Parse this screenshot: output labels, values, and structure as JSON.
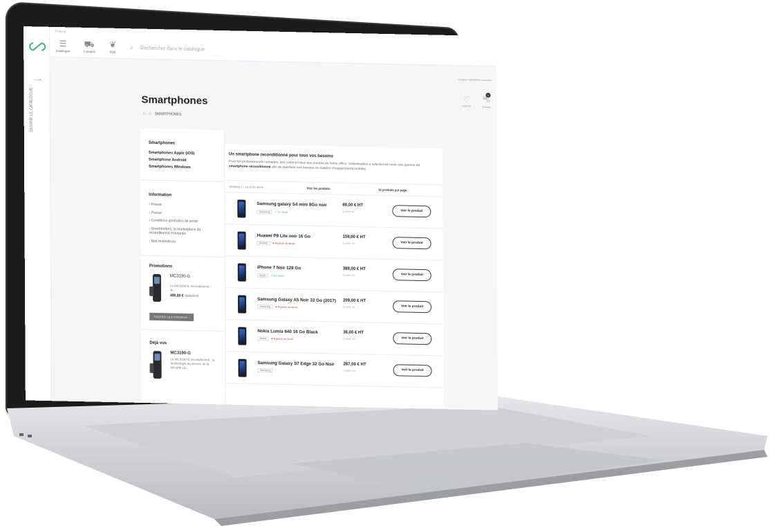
{
  "topbar": {
    "breadcrumb": "France",
    "nav": [
      {
        "label": "Catalogue",
        "icon": "hamburger-icon"
      },
      {
        "label": "A propos",
        "icon": "car-icon"
      },
      {
        "label": "RSE",
        "icon": "leaf-icon"
      }
    ],
    "search_placeholder": "Rechercher dans le catalogue",
    "links": "Livraison   Newsletter-connexion",
    "wishlist_label": "Favoris",
    "cart_label": "Panier",
    "cart_count": "0"
  },
  "rail": {
    "arrow": "⟶",
    "vertical_text": "Ouvrir le catalogue"
  },
  "page": {
    "title": "Smartphones",
    "crumb_current": "SMARTPHONES",
    "crumb_sep": "//"
  },
  "sidebar": {
    "categories_title": "Smartphones",
    "categories": [
      "Smartphones Apple (iOS)",
      "Smartphone Android",
      "Smartphones Windows"
    ],
    "info_title": "Information",
    "info_links": [
      "Presse",
      "Presse",
      "Conditions générales de vente",
      "Greentraders, la marketplace du reconditionné entreprise",
      "Nos revendeurs"
    ],
    "promo_title": "Promotions",
    "promo_item": {
      "name": "MC3190-G",
      "desc": "Le MC3190-G reconditionné : la...",
      "price": "490,00 €",
      "old_price": "550,00 €"
    },
    "promo_button": "TOUTES LES PROMOS",
    "seen_title": "Déjà vus",
    "seen_item": {
      "name": "MC3190-G",
      "desc": "Le MC3190-G reconditionné : la technologie au service de la sécurité La..."
    }
  },
  "main": {
    "intro_title": "Un smartphone reconditionné pour tous vos besoins",
    "intro_text_1": "Pour les professionnels nomades, des commerciaux aux mordus du home office, Greentraders a sélectionné toute une gamme de ",
    "intro_bold": "smartphone reconditionné",
    "intro_text_2": " afin de satisfaire vos besoins en matière d'équipements mobiles.",
    "showing": "Showing 1 - 10 of 21 items",
    "sort_label": "Trier les produits",
    "per_page": "12 produits par page",
    "from_label": "à partir de",
    "view_label": "Voir le produit",
    "products": [
      {
        "name": "Samsung galaxy S4 mini 8Go noir",
        "brand": "Samsung",
        "stock": "✓ En stock",
        "in_stock": true,
        "price": "69,00 € HT"
      },
      {
        "name": "Huawei P9 Lite noir 16 Go",
        "brand": "Huawei",
        "stock": "● Rupture de stock",
        "in_stock": false,
        "price": "159,00 € HT"
      },
      {
        "name": "iPhone 7 Noir 128 Go",
        "brand": "Apple",
        "stock": "✓ En stock",
        "in_stock": true,
        "price": "389,00 € HT"
      },
      {
        "name": "Samsung Galaxy A5 Noir 32 Go (2017)",
        "brand": "Samsung",
        "stock": "● Rupture de stock",
        "in_stock": false,
        "price": "209,00 € HT"
      },
      {
        "name": "Nokia Lumia 640 16 Go Black",
        "brand": "Nokia",
        "stock": "● Rupture de stock",
        "in_stock": false,
        "price": "36,00 € HT"
      },
      {
        "name": "Samsung Galaxy S7 Edge 32 Go Noir",
        "brand": "Samsung",
        "stock": "",
        "in_stock": true,
        "price": "267,00 € HT"
      }
    ]
  },
  "colors": {
    "accent": "#3cb371",
    "out_of_stock": "#c0392b"
  }
}
